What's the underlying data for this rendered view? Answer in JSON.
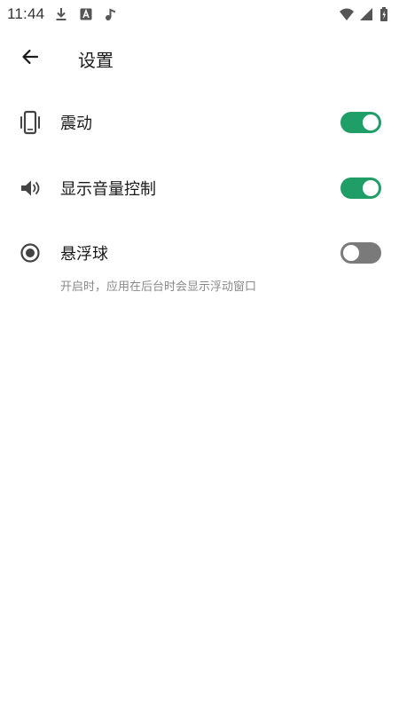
{
  "status_bar": {
    "time": "11:44",
    "left_icons": [
      "download-icon",
      "text-app-icon",
      "music-note-icon"
    ],
    "right_icons": [
      "wifi-icon",
      "cellular-signal-icon",
      "battery-charging-icon"
    ]
  },
  "app_bar": {
    "back_icon": "arrow-left-icon",
    "title": "设置"
  },
  "settings": [
    {
      "icon": "vibration-phone-icon",
      "label": "震动",
      "enabled": true
    },
    {
      "icon": "volume-icon",
      "label": "显示音量控制",
      "enabled": true
    },
    {
      "icon": "radio-target-icon",
      "label": "悬浮球",
      "enabled": false,
      "description": "开启时，应用在后台时会显示浮动窗口"
    }
  ],
  "colors": {
    "toggle_on": "#1f9e68",
    "toggle_off": "#7a7a7a",
    "text_primary": "#1a1a1a",
    "text_secondary": "#8a8a8a"
  }
}
